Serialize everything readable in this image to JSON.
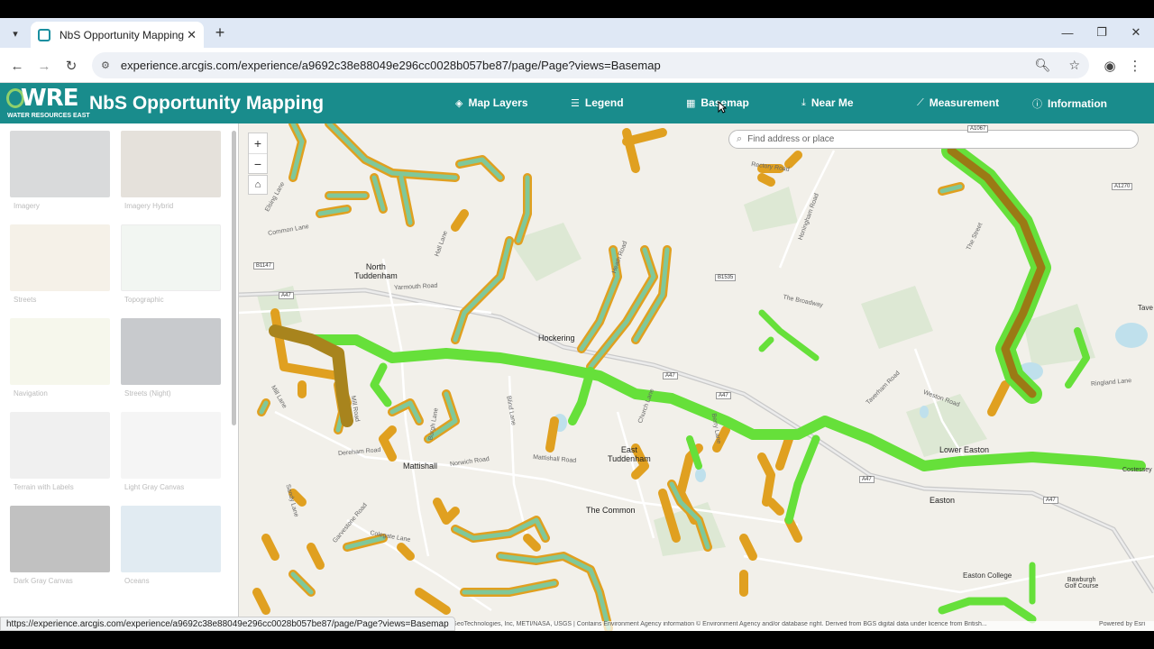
{
  "browser": {
    "tab_title": "NbS Opportunity Mapping",
    "url": "experience.arcgis.com/experience/a9692c38e88049e296cc0028b057be87/page/Page?views=Basemap",
    "status_url": "https://experience.arcgis.com/experience/a9692c38e88049e296cc0028b057be87/page/Page?views=Basemap"
  },
  "header": {
    "logo_text": "WRE",
    "logo_sub": "WATER RESOURCES EAST",
    "title": "NbS Opportunity Mapping",
    "nav": [
      {
        "label": "Map Layers",
        "icon": "layers-icon"
      },
      {
        "label": "Legend",
        "icon": "list-icon"
      },
      {
        "label": "Basemap",
        "icon": "grid-icon"
      },
      {
        "label": "Near Me",
        "icon": "download-icon"
      },
      {
        "label": "Measurement",
        "icon": "ruler-icon"
      },
      {
        "label": "Information",
        "icon": "info-icon"
      }
    ]
  },
  "gallery": {
    "items": [
      {
        "label": "Imagery",
        "color": "#b9bcbd"
      },
      {
        "label": "Imagery Hybrid",
        "color": "#cfc8bd"
      },
      {
        "label": "Streets",
        "color": "#ece6d6"
      },
      {
        "label": "Topographic",
        "color": "#e8efe9"
      },
      {
        "label": "Navigation",
        "color": "#eef0dc"
      },
      {
        "label": "Streets (Night)",
        "color": "#9a9ea4"
      },
      {
        "label": "Terrain with Labels",
        "color": "#e3e3e3"
      },
      {
        "label": "Light Gray Canvas",
        "color": "#ececec"
      },
      {
        "label": "Dark Gray Canvas",
        "color": "#8e8e8e"
      },
      {
        "label": "Oceans",
        "color": "#c9dbe8"
      }
    ]
  },
  "map": {
    "search_placeholder": "Find address or place",
    "places": [
      {
        "label": "North\nTuddenham",
        "big": true
      },
      {
        "label": "Hockering",
        "big": true
      },
      {
        "label": "Mattishall",
        "big": true
      },
      {
        "label": "East\nTuddenham",
        "big": true
      },
      {
        "label": "The Common",
        "big": true
      },
      {
        "label": "Lower Easton",
        "big": true
      },
      {
        "label": "Easton",
        "big": true
      },
      {
        "label": "Easton College",
        "big": false
      },
      {
        "label": "Bawburgh\nGolf Course",
        "big": false
      },
      {
        "label": "Costessey",
        "big": false
      },
      {
        "label": "Tave",
        "big": false
      }
    ],
    "roads": [
      "Yarmouth Road",
      "Elsing Lane",
      "Common Lane",
      "Hall Lane",
      "Heath Road",
      "Rectory Road",
      "Honingham Road",
      "The Broadway",
      "Weston Road",
      "Ringland Lane",
      "Dereham Road",
      "Norwich Road",
      "Mattishall Road",
      "Church Lane",
      "Blind Lane",
      "Burgh Lane",
      "Mill Road",
      "Colegate Lane",
      "Garvestone Road",
      "Taverham Road",
      "The Street",
      "Mill Lane",
      "Sandy Lane",
      "Berry Lane"
    ],
    "shields": [
      "A47",
      "B1147",
      "B1535",
      "A1067",
      "A1270"
    ],
    "attribution": "armin, GeoTechnologies, Inc, METI/NASA, USGS | Contains Environment Agency information © Environment Agency and/or database right. Derived from BGS digital data under licence from British...",
    "powered_by": "Powered by Esri"
  }
}
